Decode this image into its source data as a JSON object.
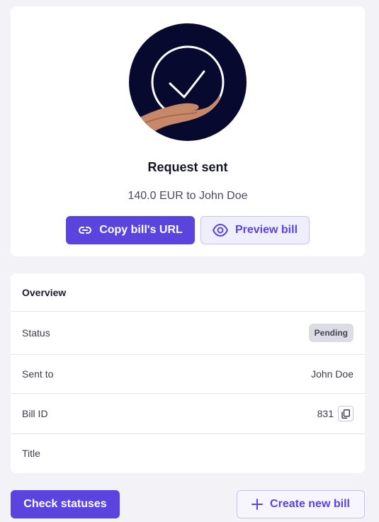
{
  "hero": {
    "title": "Request sent",
    "subtitle": "140.0 EUR to John Doe",
    "copy_label": "Copy bill's URL",
    "preview_label": "Preview bill"
  },
  "overview": {
    "heading": "Overview",
    "rows": [
      {
        "label": "Status",
        "value": "Pending"
      },
      {
        "label": "Sent to",
        "value": "John Doe"
      },
      {
        "label": "Bill ID",
        "value": "831"
      },
      {
        "label": "Title",
        "value": ""
      }
    ]
  },
  "actions": {
    "check_label": "Check statuses",
    "create_label": "Create new bill"
  },
  "icons": {
    "copy_url": "link-icon",
    "preview": "eye-icon",
    "copy_id": "copy-icon",
    "create": "plus-icon",
    "hero": "check-in-hand-icon"
  },
  "colors": {
    "accent": "#5b43e0",
    "hero_bg": "#07092f",
    "badge_bg": "#dcdde4",
    "page_bg": "#f2f2f7"
  }
}
